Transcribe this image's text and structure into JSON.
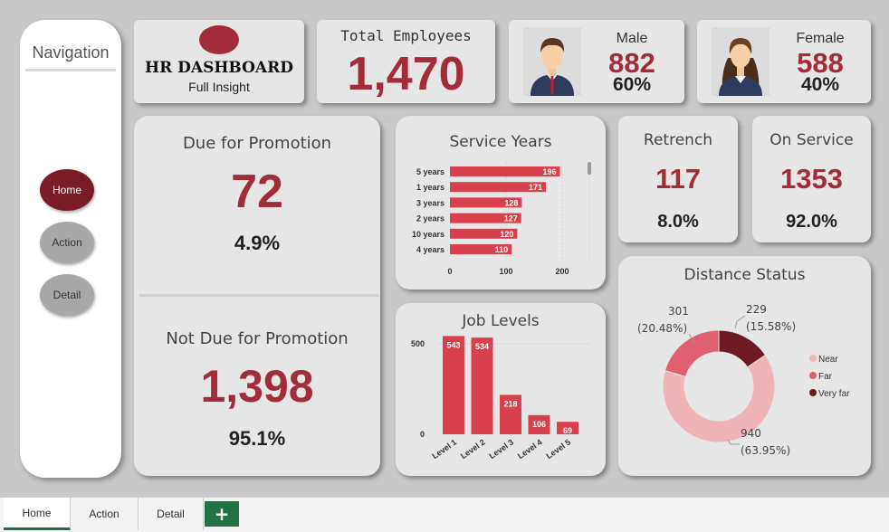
{
  "nav": {
    "title": "Navigation",
    "buttons": [
      {
        "label": "Home",
        "active": true
      },
      {
        "label": "Action",
        "active": false
      },
      {
        "label": "Detail",
        "active": false
      }
    ]
  },
  "header": {
    "title": "HR DASHBOARD",
    "subtitle": "Full Insight"
  },
  "total": {
    "label": "Total Employees",
    "value": "1,470"
  },
  "male": {
    "label": "Male",
    "value": "882",
    "pct": "60%"
  },
  "female": {
    "label": "Female",
    "value": "588",
    "pct": "40%"
  },
  "promotion": {
    "due_label": "Due for Promotion",
    "due_value": "72",
    "due_pct": "4.9%",
    "not_label": "Not Due for Promotion",
    "not_value": "1,398",
    "not_pct": "95.1%"
  },
  "retrench": {
    "label": "Retrench",
    "value": "117",
    "pct": "8.0%"
  },
  "onservice": {
    "label": "On Service",
    "value": "1353",
    "pct": "92.0%"
  },
  "colors": {
    "accent": "#a22c3a",
    "bar": "#d9404e",
    "near": "#f0b4b8",
    "far": "#e06070",
    "veryfar": "#6e1a22"
  },
  "chart_data": [
    {
      "type": "bar",
      "orientation": "horizontal",
      "title": "Service Years",
      "categories": [
        "5 years",
        "1 years",
        "3 years",
        "2 years",
        "10 years",
        "4 years"
      ],
      "values": [
        196,
        171,
        128,
        127,
        120,
        110
      ],
      "xticks": [
        "0",
        "100",
        "200"
      ],
      "xlim": [
        0,
        200
      ]
    },
    {
      "type": "bar",
      "title": "Job Levels",
      "categories": [
        "Level 1",
        "Level 2",
        "Level 3",
        "Level 4",
        "Level 5"
      ],
      "values": [
        543,
        534,
        218,
        106,
        69
      ],
      "yticks": [
        "0",
        "500"
      ],
      "ylim": [
        0,
        600
      ]
    },
    {
      "type": "pie",
      "donut": true,
      "title": "Distance Status",
      "labels": [
        "Near",
        "Far",
        "Very far"
      ],
      "values": [
        940,
        301,
        229
      ],
      "percent_labels": [
        "(63.95%)",
        "(20.48%)",
        "(15.58%)"
      ],
      "legend": "right"
    }
  ],
  "sheet_tabs": [
    {
      "label": "Home",
      "active": true
    },
    {
      "label": "Action",
      "active": false
    },
    {
      "label": "Detail",
      "active": false
    }
  ],
  "add_sheet_label": "+"
}
